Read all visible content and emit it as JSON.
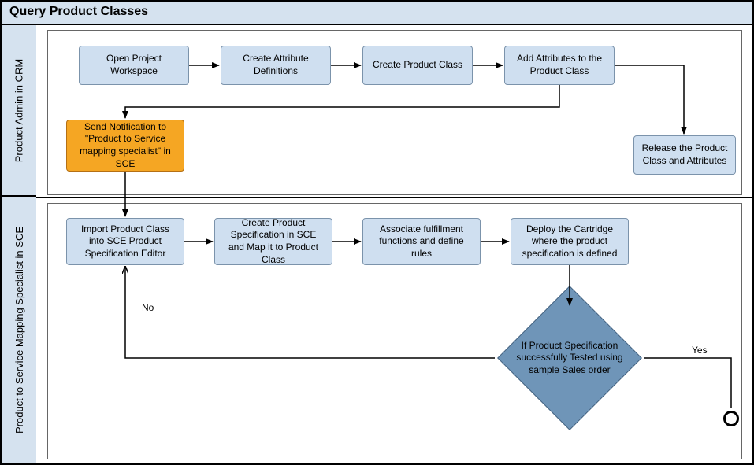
{
  "title": "Query Product Classes",
  "lanes": {
    "top": "Product Admin in CRM",
    "bottom": "Product to Service Mapping Specialist in SCE"
  },
  "nodes": {
    "openProject": "Open Project Workspace",
    "createAttr": "Create Attribute Definitions",
    "createClass": "Create Product Class",
    "addAttr": "Add Attributes to the Product Class",
    "release": "Release the Product Class and Attributes",
    "notify": "Send Notification to \"Product to Service mapping specialist\" in SCE",
    "import": "Import Product Class into SCE Product Specification Editor",
    "createSpec": "Create Product Specification in SCE and Map it to Product Class",
    "associate": "Associate fulfillment functions and define rules",
    "deploy": "Deploy the Cartridge where the product specification is defined",
    "decision": "If Product Specification successfully Tested using sample Sales order"
  },
  "edges": {
    "no": "No",
    "yes": "Yes"
  }
}
